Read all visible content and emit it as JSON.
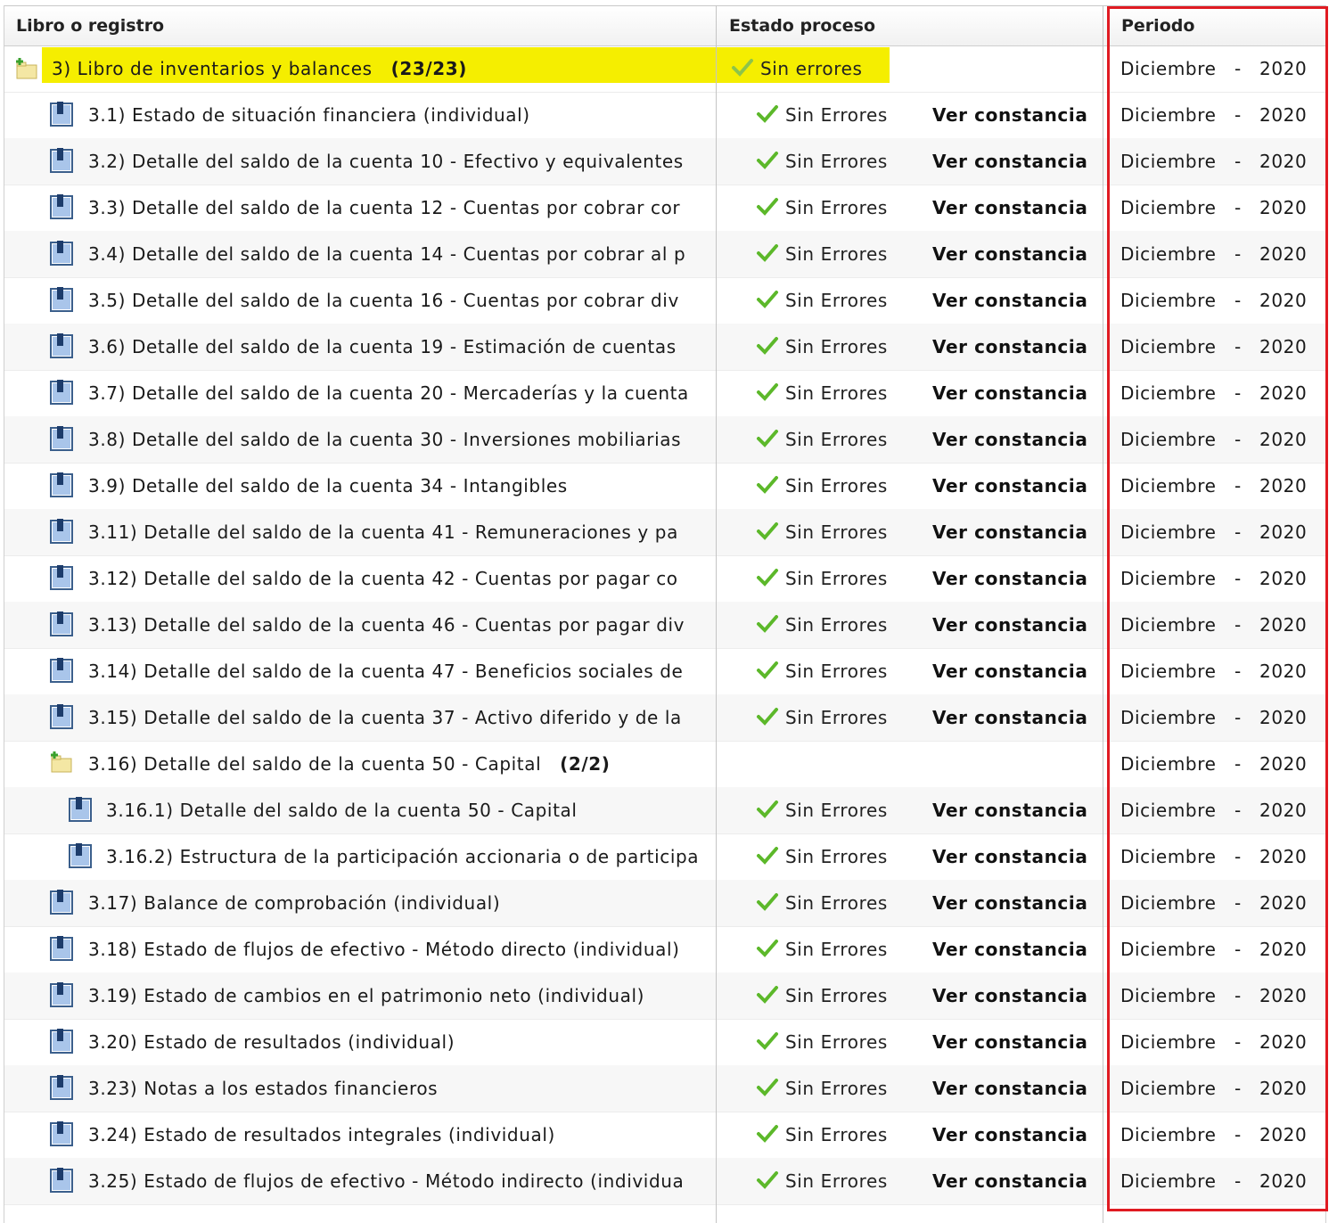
{
  "columns": {
    "book": "Libro o registro",
    "status": "Estado proceso",
    "period": "Periodo"
  },
  "parent": {
    "label": "3) Libro de inventarios y balances",
    "count": "(23/23)",
    "status": "Sin errores",
    "month": "Diciembre",
    "sep": "-",
    "year": "2020"
  },
  "rows": [
    {
      "label": "3.1) Estado de situación financiera (individual)",
      "status": "Sin Errores",
      "link": "Ver constancia",
      "month": "Diciembre",
      "sep": "-",
      "year": "2020"
    },
    {
      "label": "3.2) Detalle del saldo de la cuenta 10 - Efectivo y equivalentes",
      "status": "Sin Errores",
      "link": "Ver constancia",
      "month": "Diciembre",
      "sep": "-",
      "year": "2020"
    },
    {
      "label": "3.3) Detalle del saldo de la cuenta 12 - Cuentas por cobrar cor",
      "status": "Sin Errores",
      "link": "Ver constancia",
      "month": "Diciembre",
      "sep": "-",
      "year": "2020"
    },
    {
      "label": "3.4) Detalle del saldo de la cuenta 14 - Cuentas por cobrar al p",
      "status": "Sin Errores",
      "link": "Ver constancia",
      "month": "Diciembre",
      "sep": "-",
      "year": "2020"
    },
    {
      "label": "3.5) Detalle del saldo de la cuenta 16 - Cuentas por cobrar div",
      "status": "Sin Errores",
      "link": "Ver constancia",
      "month": "Diciembre",
      "sep": "-",
      "year": "2020"
    },
    {
      "label": "3.6) Detalle del saldo de la cuenta 19 - Estimación de cuentas",
      "status": "Sin Errores",
      "link": "Ver constancia",
      "month": "Diciembre",
      "sep": "-",
      "year": "2020"
    },
    {
      "label": "3.7) Detalle del saldo de la cuenta 20 - Mercaderías y la cuenta",
      "status": "Sin Errores",
      "link": "Ver constancia",
      "month": "Diciembre",
      "sep": "-",
      "year": "2020"
    },
    {
      "label": "3.8) Detalle del saldo de la cuenta 30 - Inversiones mobiliarias",
      "status": "Sin Errores",
      "link": "Ver constancia",
      "month": "Diciembre",
      "sep": "-",
      "year": "2020"
    },
    {
      "label": "3.9) Detalle del saldo de la cuenta 34 - Intangibles",
      "status": "Sin Errores",
      "link": "Ver constancia",
      "month": "Diciembre",
      "sep": "-",
      "year": "2020"
    },
    {
      "label": "3.11) Detalle del saldo de la cuenta 41 - Remuneraciones y pa",
      "status": "Sin Errores",
      "link": "Ver constancia",
      "month": "Diciembre",
      "sep": "-",
      "year": "2020"
    },
    {
      "label": "3.12) Detalle del saldo de la cuenta 42 - Cuentas por pagar co",
      "status": "Sin Errores",
      "link": "Ver constancia",
      "month": "Diciembre",
      "sep": "-",
      "year": "2020"
    },
    {
      "label": "3.13) Detalle del saldo de la cuenta 46 - Cuentas por pagar div",
      "status": "Sin Errores",
      "link": "Ver constancia",
      "month": "Diciembre",
      "sep": "-",
      "year": "2020"
    },
    {
      "label": "3.14) Detalle del saldo de la cuenta 47 - Beneficios sociales de",
      "status": "Sin Errores",
      "link": "Ver constancia",
      "month": "Diciembre",
      "sep": "-",
      "year": "2020"
    },
    {
      "label": "3.15) Detalle del saldo de la cuenta 37 - Activo diferido y de la",
      "status": "Sin Errores",
      "link": "Ver constancia",
      "month": "Diciembre",
      "sep": "-",
      "year": "2020"
    },
    {
      "label": "3.16) Detalle del saldo de la cuenta 50 - Capital",
      "count": "(2/2)",
      "folder": true,
      "month": "Diciembre",
      "sep": "-",
      "year": "2020"
    },
    {
      "label": "3.16.1) Detalle del saldo de la cuenta 50 - Capital",
      "status": "Sin Errores",
      "link": "Ver constancia",
      "month": "Diciembre",
      "sep": "-",
      "year": "2020",
      "sub": true
    },
    {
      "label": "3.16.2) Estructura de la participación accionaria o de participa",
      "status": "Sin Errores",
      "link": "Ver constancia",
      "month": "Diciembre",
      "sep": "-",
      "year": "2020",
      "sub": true
    },
    {
      "label": "3.17) Balance de comprobación (individual)",
      "status": "Sin Errores",
      "link": "Ver constancia",
      "month": "Diciembre",
      "sep": "-",
      "year": "2020"
    },
    {
      "label": "3.18) Estado de flujos de efectivo - Método directo (individual)",
      "status": "Sin Errores",
      "link": "Ver constancia",
      "month": "Diciembre",
      "sep": "-",
      "year": "2020"
    },
    {
      "label": "3.19) Estado de cambios en el patrimonio neto (individual)",
      "status": "Sin Errores",
      "link": "Ver constancia",
      "month": "Diciembre",
      "sep": "-",
      "year": "2020"
    },
    {
      "label": "3.20) Estado de resultados (individual)",
      "status": "Sin Errores",
      "link": "Ver constancia",
      "month": "Diciembre",
      "sep": "-",
      "year": "2020"
    },
    {
      "label": "3.23) Notas a los estados financieros",
      "status": "Sin Errores",
      "link": "Ver constancia",
      "month": "Diciembre",
      "sep": "-",
      "year": "2020"
    },
    {
      "label": "3.24) Estado de resultados integrales (individual)",
      "status": "Sin Errores",
      "link": "Ver constancia",
      "month": "Diciembre",
      "sep": "-",
      "year": "2020"
    },
    {
      "label": "3.25) Estado de flujos de efectivo - Método indirecto (individua",
      "status": "Sin Errores",
      "link": "Ver constancia",
      "month": "Diciembre",
      "sep": "-",
      "year": "2020"
    }
  ],
  "colors": {
    "highlight": "#f5ee00",
    "annotation_box": "#e01b22",
    "check": "#5cb82a"
  },
  "icons": {
    "folder": "folder-plus-icon",
    "document": "document-icon",
    "status": "check-icon"
  }
}
